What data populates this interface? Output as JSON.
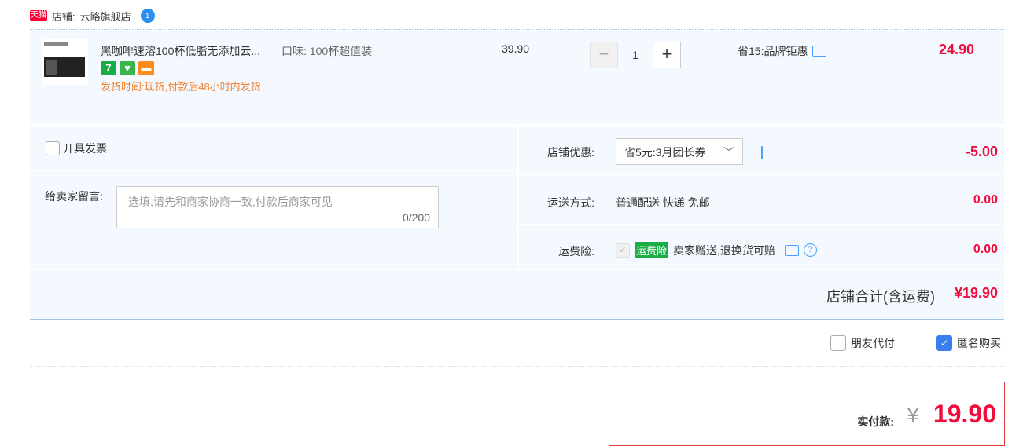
{
  "shop": {
    "badge": "天猫",
    "label": "店铺:",
    "name": "云路旗舰店",
    "ww": "1"
  },
  "item": {
    "title": "黑咖啡速溶100杯低脂无添加云...",
    "sku_label": "口味:",
    "sku_value": "100杯超值装",
    "tags": [
      {
        "text": "7",
        "color": "#1aad45"
      },
      {
        "text": "♥",
        "color": "#39b54a"
      },
      {
        "text": "▬",
        "color": "#ff8c1a"
      }
    ],
    "ship_time": "发货时间:现货,付款后48小时内发货",
    "price": "39.90",
    "qty": "1",
    "promo": "省15:品牌钜惠",
    "subtotal": "24.90"
  },
  "invoice": {
    "label": "开具发票"
  },
  "message": {
    "label": "给卖家留言:",
    "placeholder": "选填,请先和商家协商一致,付款后商家可见",
    "count": "0/200"
  },
  "shop_discount": {
    "label": "店铺优惠:",
    "value": "省5元:3月团长券",
    "amount": "-5.00"
  },
  "delivery": {
    "label": "运送方式:",
    "value": "普通配送 快递 免邮",
    "amount": "0.00"
  },
  "insurance": {
    "label": "运费险:",
    "badge": "运费险",
    "text": "卖家赠送,退换货可赔",
    "amount": "0.00"
  },
  "summary": {
    "label": "店铺合计(含运费)",
    "value": "¥19.90"
  },
  "options": {
    "friend_pay": "朋友代付",
    "anonymous": "匿名购买"
  },
  "pay": {
    "label": "实付款:",
    "yen": "¥",
    "value": "19.90"
  }
}
